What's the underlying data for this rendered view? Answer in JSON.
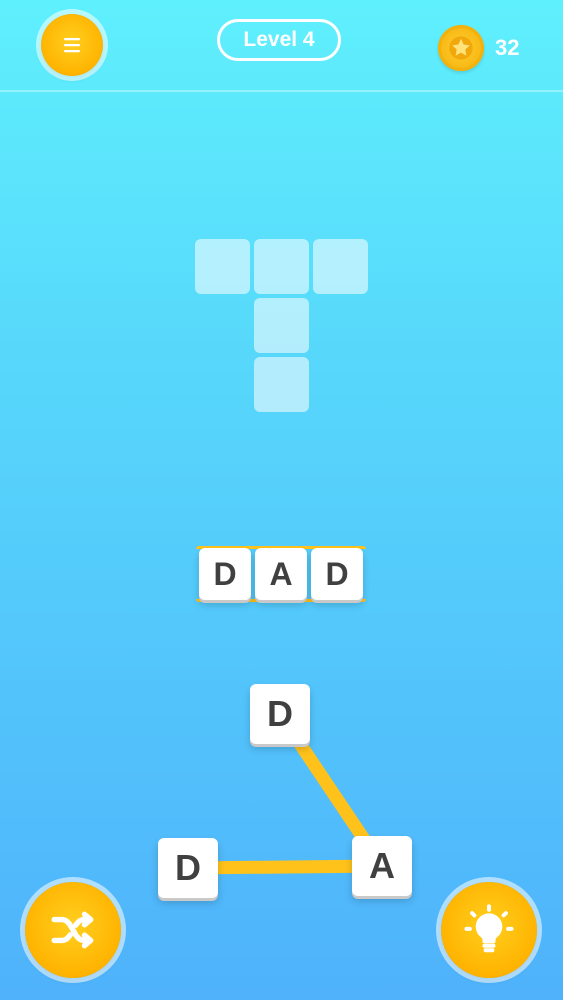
{
  "header": {
    "level_label": "Level 4",
    "coins": "32"
  },
  "icons": {
    "menu": "menu-icon",
    "coin": "star-coin-icon",
    "shuffle": "shuffle-icon",
    "hint": "lightbulb-icon"
  },
  "colors": {
    "accent": "#ffb300",
    "line": "#ffc21a",
    "tile_text": "#404040"
  },
  "crossword": {
    "cells": 5
  },
  "guess": {
    "letters": [
      "D",
      "A",
      "D"
    ]
  },
  "wheel": {
    "letters": [
      "D",
      "D",
      "A"
    ]
  }
}
